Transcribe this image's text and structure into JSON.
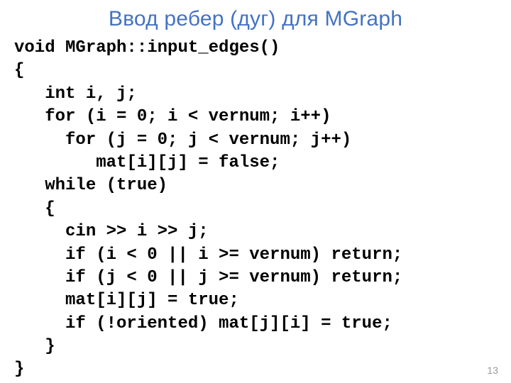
{
  "title": "Ввод ребер (дуг) для MGraph",
  "code": {
    "l01": "void MGraph::input_edges()",
    "l02": "{",
    "l03": "   int i, j;",
    "l04": "   for (i = 0; i < vernum; i++)",
    "l05": "     for (j = 0; j < vernum; j++)",
    "l06": "        mat[i][j] = false;",
    "l07": "   while (true)",
    "l08": "   {",
    "l09": "     cin >> i >> j;",
    "l10": "     if (i < 0 || i >= vernum) return;",
    "l11": "     if (j < 0 || j >= vernum) return;",
    "l12": "     mat[i][j] = true;",
    "l13": "     if (!oriented) mat[j][i] = true;",
    "l14": "   }",
    "l15": "}"
  },
  "page_number": "13"
}
